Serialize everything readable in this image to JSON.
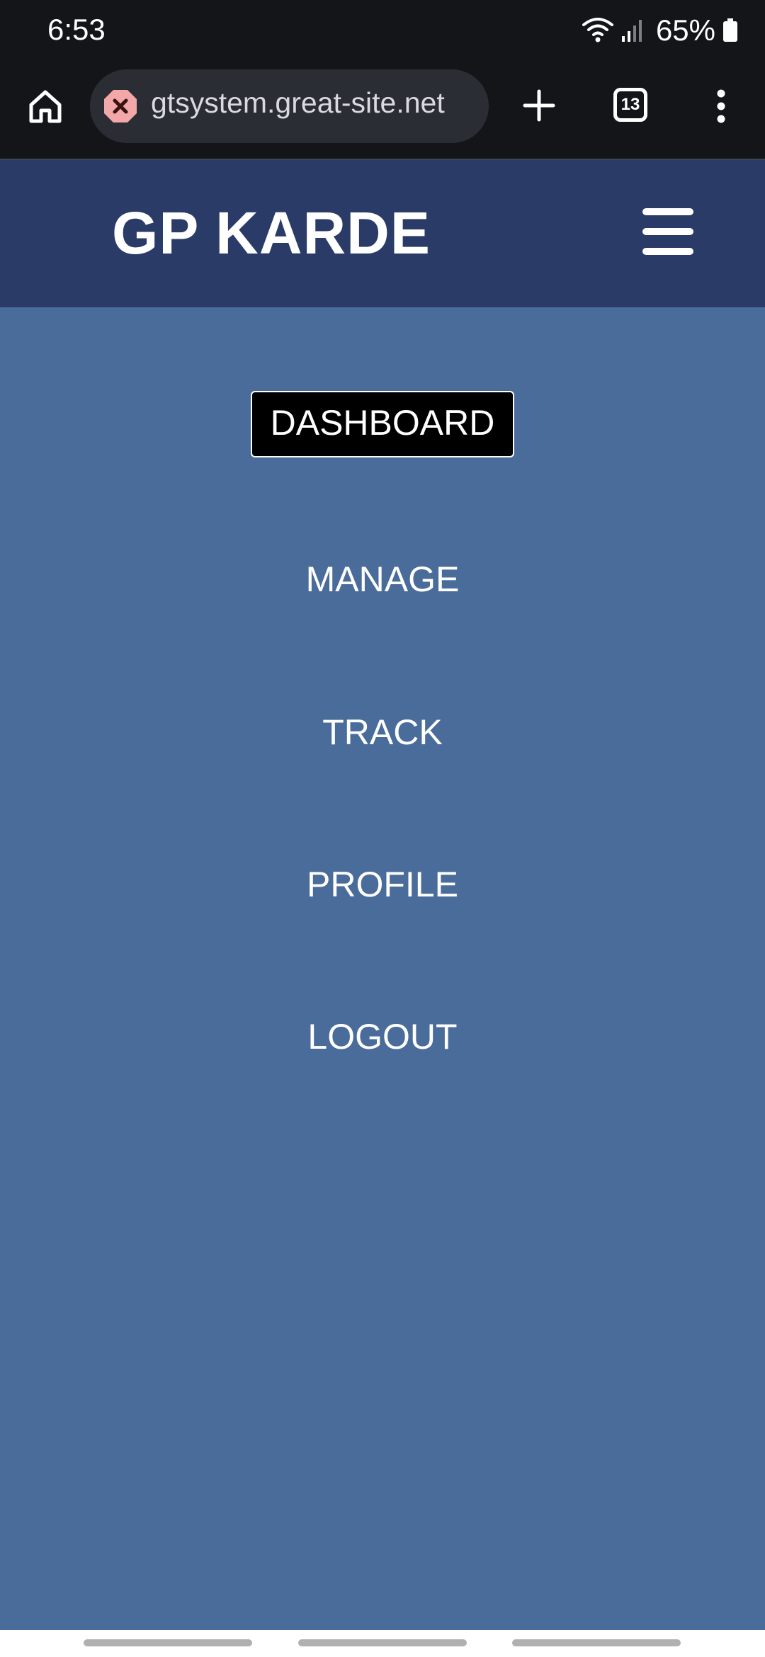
{
  "status_bar": {
    "time": "6:53",
    "battery": "65%"
  },
  "browser": {
    "url": "gtsystem.great-site.net",
    "tab_count": "13",
    "icons": [
      "home-icon",
      "site-error-icon",
      "plus-icon",
      "tabs-icon",
      "more-vert-icon"
    ]
  },
  "header": {
    "title": "GP KARDE",
    "menu_icon": "hamburger-icon"
  },
  "nav": {
    "items": [
      {
        "label": "DASHBOARD",
        "active": true
      },
      {
        "label": "MANAGE",
        "active": false
      },
      {
        "label": "TRACK",
        "active": false
      },
      {
        "label": "PROFILE",
        "active": false
      },
      {
        "label": "LOGOUT",
        "active": false
      }
    ]
  },
  "colors": {
    "header_bg": "#293b66",
    "nav_bg": "#4a6c9a",
    "active_bg": "#000000",
    "browser_bg": "#131519"
  }
}
